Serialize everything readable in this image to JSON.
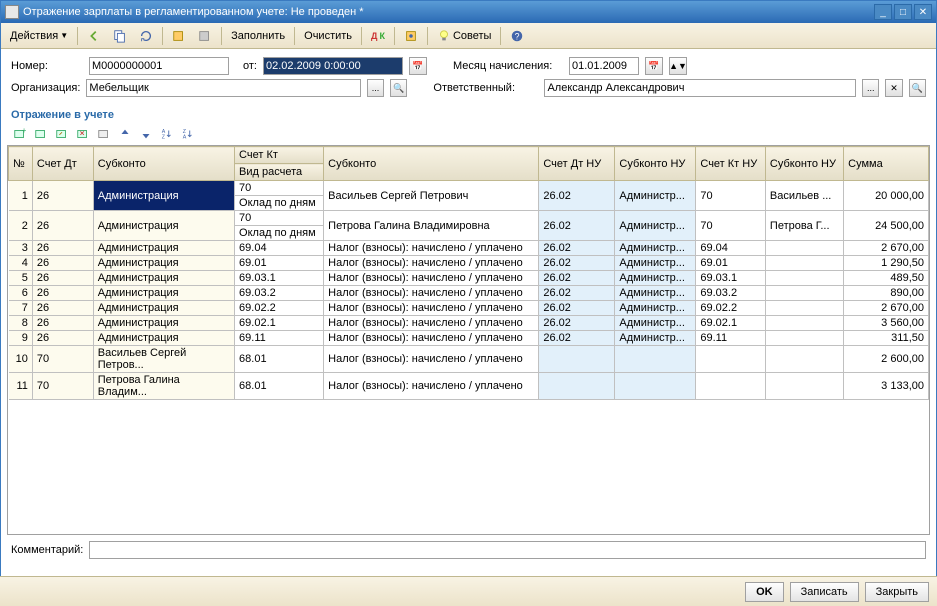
{
  "title": "Отражение зарплаты в регламентированном учете: Не проведен *",
  "toolbar": {
    "actions": "Действия",
    "fill": "Заполнить",
    "clear": "Очистить",
    "tips": "Советы"
  },
  "form": {
    "number_label": "Номер:",
    "number_value": "М0000000001",
    "from_label": "от:",
    "from_value": "02.02.2009 0:00:00",
    "month_label": "Месяц начисления:",
    "month_value": "01.01.2009",
    "org_label": "Организация:",
    "org_value": "Мебельщик",
    "resp_label": "Ответственный:",
    "resp_value": "Александр Александрович"
  },
  "section_title": "Отражение в учете",
  "grid": {
    "headers": {
      "n": "№",
      "acc_dt": "Счет Дт",
      "subkonto": "Субконто",
      "acc_kt": "Счет Кт",
      "calc_type": "Вид расчета",
      "subkonto2": "Субконто",
      "acc_dt_nu": "Счет Дт НУ",
      "subkonto_nu": "Субконто НУ",
      "acc_kt_nu": "Счет Кт НУ",
      "subkonto_nu2": "Субконто НУ",
      "sum": "Сумма"
    },
    "rows": [
      {
        "n": "1",
        "acc_dt": "26",
        "subkonto": "Администрация",
        "acc_kt": "70",
        "calc": "Оклад по дням",
        "subkonto2": "Васильев Сергей Петрович",
        "acc_dt_nu": "26.02",
        "sub_nu": "Администр...",
        "acc_kt_nu": "70",
        "sub_nu2": "Васильев ...",
        "sum": "20 000,00"
      },
      {
        "n": "2",
        "acc_dt": "26",
        "subkonto": "Администрация",
        "acc_kt": "70",
        "calc": "Оклад по дням",
        "subkonto2": "Петрова Галина Владимировна",
        "acc_dt_nu": "26.02",
        "sub_nu": "Администр...",
        "acc_kt_nu": "70",
        "sub_nu2": "Петрова Г...",
        "sum": "24 500,00"
      },
      {
        "n": "3",
        "acc_dt": "26",
        "subkonto": "Администрация",
        "acc_kt": "69.04",
        "calc": "",
        "subkonto2": "Налог (взносы): начислено / уплачено",
        "acc_dt_nu": "26.02",
        "sub_nu": "Администр...",
        "acc_kt_nu": "69.04",
        "sub_nu2": "",
        "sum": "2 670,00"
      },
      {
        "n": "4",
        "acc_dt": "26",
        "subkonto": "Администрация",
        "acc_kt": "69.01",
        "calc": "",
        "subkonto2": "Налог (взносы): начислено / уплачено",
        "acc_dt_nu": "26.02",
        "sub_nu": "Администр...",
        "acc_kt_nu": "69.01",
        "sub_nu2": "",
        "sum": "1 290,50"
      },
      {
        "n": "5",
        "acc_dt": "26",
        "subkonto": "Администрация",
        "acc_kt": "69.03.1",
        "calc": "",
        "subkonto2": "Налог (взносы): начислено / уплачено",
        "acc_dt_nu": "26.02",
        "sub_nu": "Администр...",
        "acc_kt_nu": "69.03.1",
        "sub_nu2": "",
        "sum": "489,50"
      },
      {
        "n": "6",
        "acc_dt": "26",
        "subkonto": "Администрация",
        "acc_kt": "69.03.2",
        "calc": "",
        "subkonto2": "Налог (взносы): начислено / уплачено",
        "acc_dt_nu": "26.02",
        "sub_nu": "Администр...",
        "acc_kt_nu": "69.03.2",
        "sub_nu2": "",
        "sum": "890,00"
      },
      {
        "n": "7",
        "acc_dt": "26",
        "subkonto": "Администрация",
        "acc_kt": "69.02.2",
        "calc": "",
        "subkonto2": "Налог (взносы): начислено / уплачено",
        "acc_dt_nu": "26.02",
        "sub_nu": "Администр...",
        "acc_kt_nu": "69.02.2",
        "sub_nu2": "",
        "sum": "2 670,00"
      },
      {
        "n": "8",
        "acc_dt": "26",
        "subkonto": "Администрация",
        "acc_kt": "69.02.1",
        "calc": "",
        "subkonto2": "Налог (взносы): начислено / уплачено",
        "acc_dt_nu": "26.02",
        "sub_nu": "Администр...",
        "acc_kt_nu": "69.02.1",
        "sub_nu2": "",
        "sum": "3 560,00"
      },
      {
        "n": "9",
        "acc_dt": "26",
        "subkonto": "Администрация",
        "acc_kt": "69.11",
        "calc": "",
        "subkonto2": "Налог (взносы): начислено / уплачено",
        "acc_dt_nu": "26.02",
        "sub_nu": "Администр...",
        "acc_kt_nu": "69.11",
        "sub_nu2": "",
        "sum": "311,50"
      },
      {
        "n": "10",
        "acc_dt": "70",
        "subkonto": "Васильев Сергей Петров...",
        "acc_kt": "68.01",
        "calc": "",
        "subkonto2": "Налог (взносы): начислено / уплачено",
        "acc_dt_nu": "",
        "sub_nu": "",
        "acc_kt_nu": "",
        "sub_nu2": "",
        "sum": "2 600,00"
      },
      {
        "n": "11",
        "acc_dt": "70",
        "subkonto": "Петрова Галина Владим...",
        "acc_kt": "68.01",
        "calc": "",
        "subkonto2": "Налог (взносы): начислено / уплачено",
        "acc_dt_nu": "",
        "sub_nu": "",
        "acc_kt_nu": "",
        "sub_nu2": "",
        "sum": "3 133,00"
      }
    ]
  },
  "comment_label": "Комментарий:",
  "buttons": {
    "ok": "OK",
    "save": "Записать",
    "close": "Закрыть"
  }
}
